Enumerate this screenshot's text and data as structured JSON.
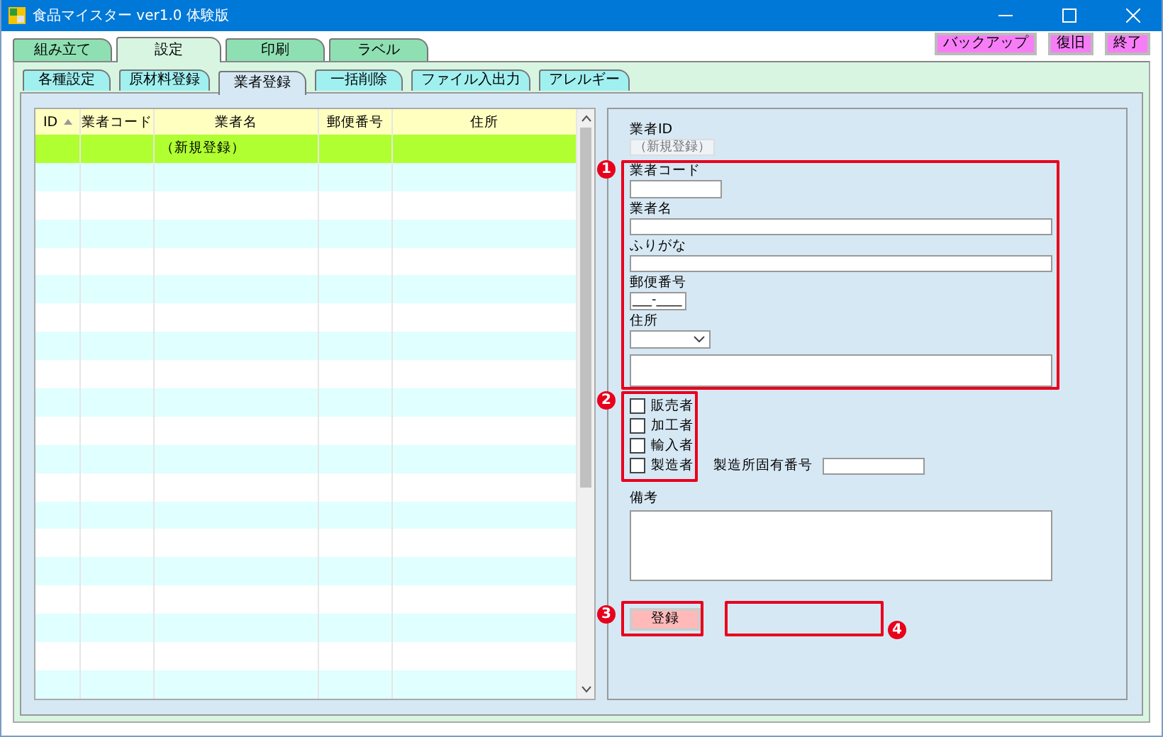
{
  "window": {
    "title": "食品マイスター ver1.0 体験版"
  },
  "main_tabs": [
    {
      "label": "組み立て",
      "selected": false
    },
    {
      "label": "設定",
      "selected": true
    },
    {
      "label": "印刷",
      "selected": false
    },
    {
      "label": "ラベル",
      "selected": false
    }
  ],
  "toolbar_buttons": [
    "バックアップ",
    "復旧",
    "終了"
  ],
  "sub_tabs": [
    {
      "label": "各種設定",
      "selected": false
    },
    {
      "label": "原材料登録",
      "selected": false
    },
    {
      "label": "業者登録",
      "selected": true
    },
    {
      "label": "一括削除",
      "selected": false
    },
    {
      "label": "ファイル入出力",
      "selected": false
    },
    {
      "label": "アレルギー",
      "selected": false
    }
  ],
  "table": {
    "columns": [
      "ID",
      "業者コード",
      "業者名",
      "郵便番号",
      "住所"
    ],
    "rows": [
      {
        "name": "（新規登録）",
        "selected": true
      }
    ]
  },
  "form": {
    "id_label": "業者ID",
    "id_value": "（新規登録）",
    "fields": [
      {
        "label": "業者コード",
        "kind": "short"
      },
      {
        "label": "業者名",
        "kind": "wide"
      },
      {
        "label": "ふりがな",
        "kind": "wide"
      },
      {
        "label": "郵便番号",
        "kind": "postal",
        "value": "___-____"
      },
      {
        "label": "住所",
        "kind": "address"
      }
    ],
    "checkboxes": [
      {
        "label": "販売者",
        "checked": false
      },
      {
        "label": "加工者",
        "checked": false
      },
      {
        "label": "輸入者",
        "checked": false
      },
      {
        "label": "製造者",
        "checked": false
      }
    ],
    "factory_label": "製造所固有番号",
    "notes_label": "備考",
    "register_button": "登録"
  },
  "annotations": [
    {
      "number": "1"
    },
    {
      "number": "2"
    },
    {
      "number": "3"
    },
    {
      "number": "4"
    }
  ]
}
